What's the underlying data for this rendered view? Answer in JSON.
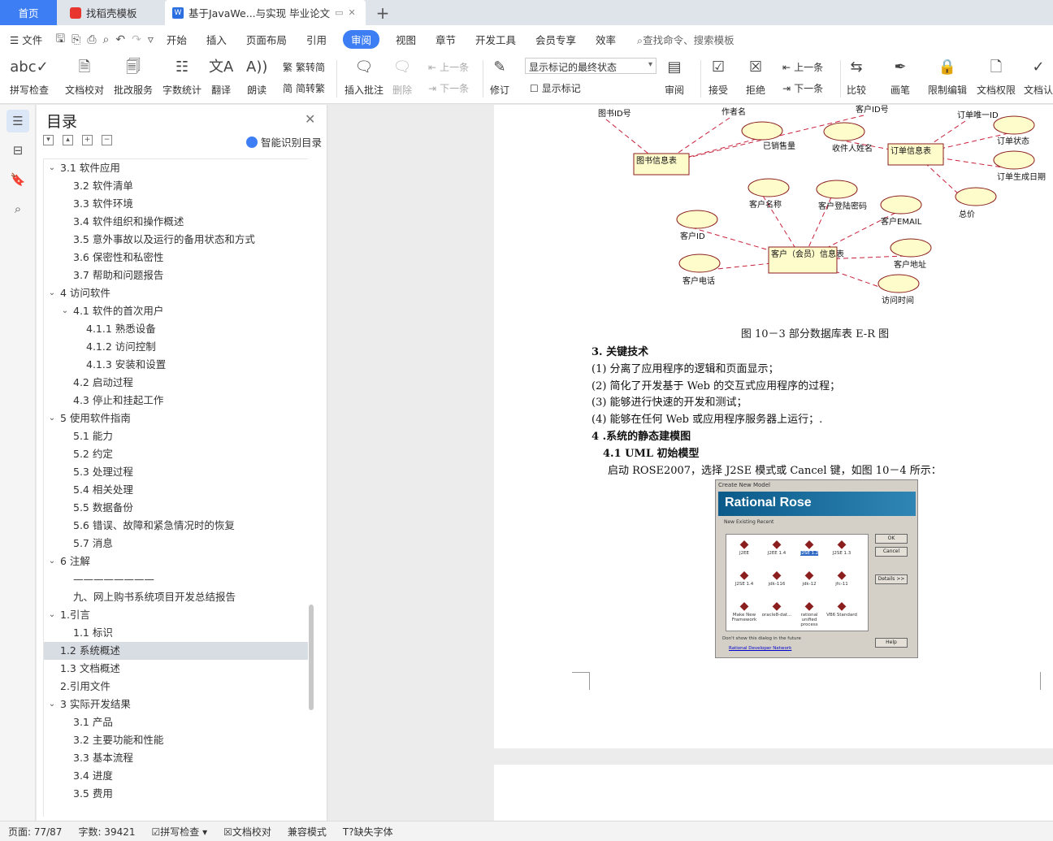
{
  "tabs": {
    "home": "首页",
    "template": "找稻壳模板",
    "document": "基于JavaWe...与实现 毕业论文"
  },
  "menu": {
    "file": "文件",
    "items": [
      "开始",
      "插入",
      "页面布局",
      "引用",
      "审阅",
      "视图",
      "章节",
      "开发工具",
      "会员专享",
      "效率"
    ],
    "active": "审阅",
    "search": "查找命令、搜索模板"
  },
  "ribbon": {
    "spell": "拼写检查",
    "proof": "文档校对",
    "batch": "批改服务",
    "count": "字数统计",
    "translate": "翻译",
    "read": "朗读",
    "trad": "繁转简",
    "simp": "简转繁",
    "insert_comment": "插入批注",
    "delete": "删除",
    "prev1": "上一条",
    "next1": "下一条",
    "revise": "修订",
    "markup_select": "显示标记的最终状态",
    "show_markup": "显示标记",
    "review": "审阅",
    "accept": "接受",
    "reject": "拒绝",
    "prev2": "上一条",
    "next2": "下一条",
    "compare": "比较",
    "pen": "画笔",
    "restrict": "限制编辑",
    "rights": "文档权限",
    "verify": "文档认"
  },
  "toc": {
    "title": "目录",
    "smart": "智能识别目录",
    "items": [
      {
        "t": "3.1 软件应用",
        "l": 1,
        "c": 1
      },
      {
        "t": "3.2 软件清单",
        "l": 2
      },
      {
        "t": "3.3 软件环境",
        "l": 2
      },
      {
        "t": "3.4 软件组织和操作概述",
        "l": 2
      },
      {
        "t": "3.5 意外事故以及运行的备用状态和方式",
        "l": 2
      },
      {
        "t": "3.6 保密性和私密性",
        "l": 2
      },
      {
        "t": "3.7 帮助和问题报告",
        "l": 2
      },
      {
        "t": "4 访问软件",
        "l": 1,
        "c": 1
      },
      {
        "t": "4.1 软件的首次用户",
        "l": 2,
        "c": 1
      },
      {
        "t": "4.1.1 熟悉设备",
        "l": 3
      },
      {
        "t": "4.1.2 访问控制",
        "l": 3
      },
      {
        "t": "4.1.3 安装和设置",
        "l": 3
      },
      {
        "t": "4.2 启动过程",
        "l": 2
      },
      {
        "t": "4.3 停止和挂起工作",
        "l": 2
      },
      {
        "t": "5 使用软件指南",
        "l": 1,
        "c": 1
      },
      {
        "t": "5.1 能力",
        "l": 2
      },
      {
        "t": "5.2 约定",
        "l": 2
      },
      {
        "t": "5.3 处理过程",
        "l": 2
      },
      {
        "t": "5.4 相关处理",
        "l": 2
      },
      {
        "t": "5.5 数据备份",
        "l": 2
      },
      {
        "t": "5.6 错误、故障和紧急情况时的恢复",
        "l": 2
      },
      {
        "t": "5.7 消息",
        "l": 2
      },
      {
        "t": "6 注解",
        "l": 1,
        "c": 1
      },
      {
        "t": "————————",
        "l": 2
      },
      {
        "t": "九、网上购书系统项目开发总结报告",
        "l": 2
      },
      {
        "t": "1.引言",
        "l": 1,
        "c": 1
      },
      {
        "t": "1.1 标识",
        "l": 2
      },
      {
        "t": "1.2 系统概述",
        "l": 1,
        "sel": 1
      },
      {
        "t": "1.3 文档概述",
        "l": 1
      },
      {
        "t": "2.引用文件",
        "l": 1
      },
      {
        "t": "3 实际开发结果",
        "l": 1,
        "c": 1
      },
      {
        "t": "3.1 产品",
        "l": 2
      },
      {
        "t": "3.2 主要功能和性能",
        "l": 2
      },
      {
        "t": "3.3 基本流程",
        "l": 2
      },
      {
        "t": "3.4 进度",
        "l": 2
      },
      {
        "t": "3.5 费用",
        "l": 2
      }
    ]
  },
  "erd": {
    "entities": [
      "图书信息表",
      "订单信息表",
      "客户（会员）信息表"
    ],
    "attrs": [
      "图书ID号",
      "作者名",
      "已销售量",
      "客户ID号",
      "收件人姓名",
      "订单唯一ID",
      "订单状态",
      "订单生成日期",
      "总价",
      "客户名称",
      "客户登陆密码",
      "客户EMAIL",
      "客户ID",
      "客户地址",
      "客户电话",
      "访问时间"
    ]
  },
  "doc": {
    "caption": "图 10－3 部分数据库表 E-R 图",
    "h1": "3. 关键技术",
    "p1": "(1) 分离了应用程序的逻辑和页面显示；",
    "p2": "(2) 简化了开发基于 Web 的交互式应用程序的过程；",
    "p3": "(3) 能够进行快速的开发和测试；",
    "p4": "(4) 能够在任何 Web 或应用程序服务器上运行；.",
    "h2": "4 .系统的静态建模图",
    "h3": "4.1  UML 初始模型",
    "p5": "启动 ROSE2007，选择 J2SE 模式或 Cancel 键，如图 10－4 所示："
  },
  "rose": {
    "title": "Create New Model",
    "banner": "Rational Rose",
    "tabs": "New   Existing   Recent",
    "items": [
      "J2EE",
      "J2EE 1.4",
      "J2SE 1.2",
      "J2SE 1.3",
      "J2SE 1.4",
      "jdk-116",
      "jdk-12",
      "jfc-11",
      "Make New Framework",
      "oracle8-dat...",
      "rational unified process",
      "VB6 Standard"
    ],
    "ok": "OK",
    "cancel": "Cancel",
    "details": "Details >>",
    "help": "Help",
    "dont": "Don't show this dialog in the future",
    "link": "Rational Developer Network"
  },
  "status": {
    "page": "页面: 77/87",
    "words": "字数: 39421",
    "spell": "拼写检查",
    "proof": "文档校对",
    "compat": "兼容模式",
    "font": "缺失字体"
  }
}
